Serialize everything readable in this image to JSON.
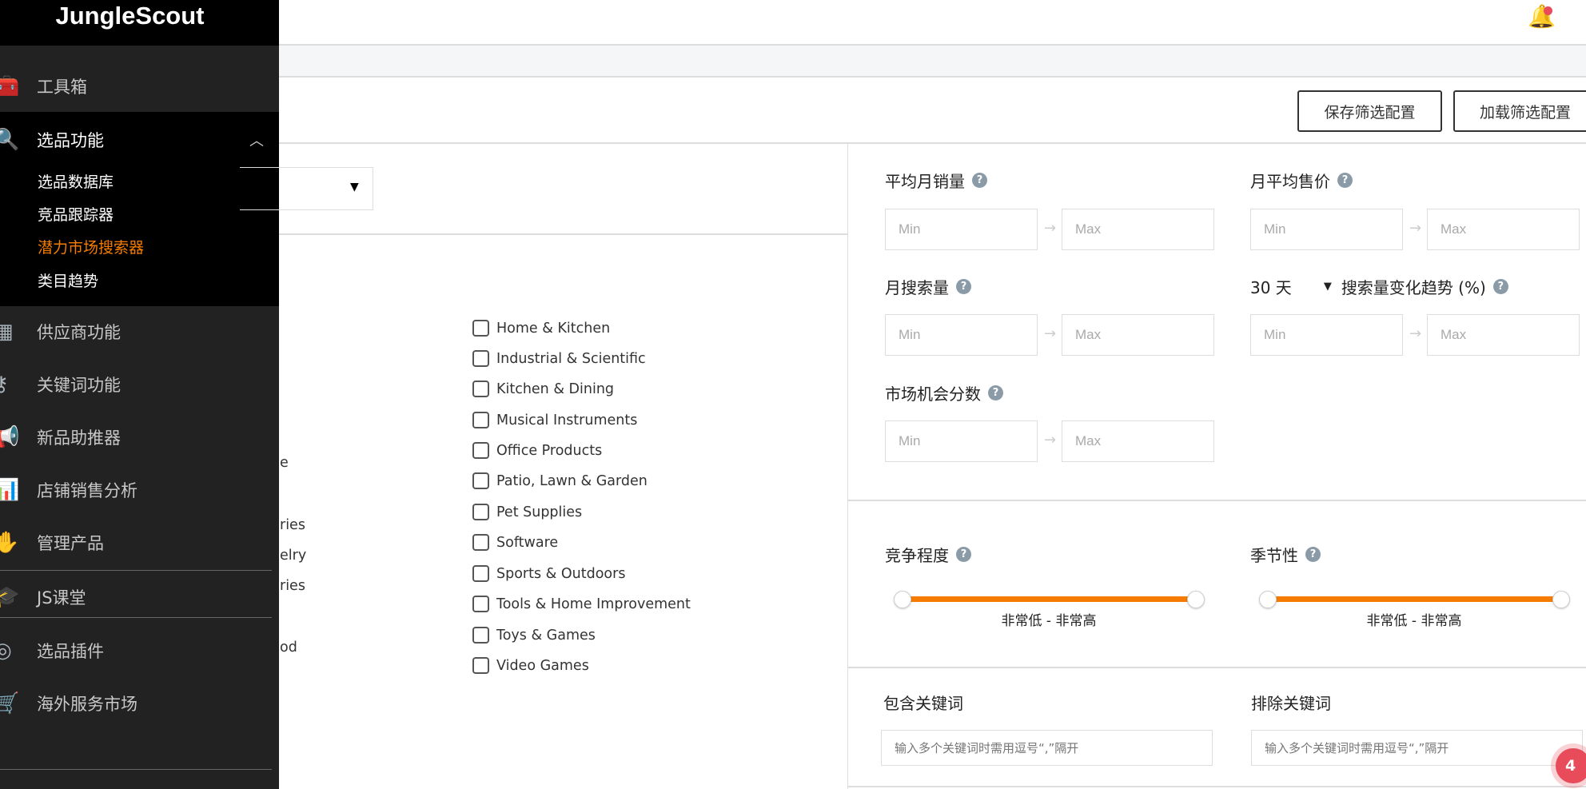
{
  "sidebar": {
    "logo": "JungleScout",
    "items": [
      {
        "label": "工具箱",
        "icon": "toolbox-icon"
      },
      {
        "label": "选品功能",
        "icon": "product-search-icon",
        "expanded": true,
        "children": [
          "选品数据库",
          "竞品跟踪器",
          "潜力市场搜索器",
          "类目趋势"
        ],
        "active_child": "潜力市场搜索器"
      },
      {
        "label": "供应商功能",
        "icon": "factory-icon"
      },
      {
        "label": "关键词功能",
        "icon": "key-icon"
      },
      {
        "label": "新品助推器",
        "icon": "megaphone-icon"
      },
      {
        "label": "店铺销售分析",
        "icon": "bar-chart-icon"
      },
      {
        "label": "管理产品",
        "icon": "hand-box-icon"
      },
      {
        "label": "JS课堂",
        "icon": "graduation-cap-icon"
      },
      {
        "label": "选品插件",
        "icon": "chrome-icon"
      },
      {
        "label": "海外服务市场",
        "icon": "cart-icon"
      }
    ]
  },
  "toolbar": {
    "save_label": "保存筛选配置",
    "load_label": "加载筛选配置"
  },
  "categories": {
    "partial_left": [
      "e",
      "ries",
      "elry",
      "ries",
      "od"
    ],
    "items": [
      "Home & Kitchen",
      "Industrial & Scientific",
      "Kitchen & Dining",
      "Musical Instruments",
      "Office Products",
      "Patio, Lawn & Garden",
      "Pet Supplies",
      "Software",
      "Sports & Outdoors",
      "Tools & Home Improvement",
      "Toys & Games",
      "Video Games"
    ]
  },
  "filters": {
    "min_placeholder": "Min",
    "max_placeholder": "Max",
    "avg_monthly_sales": "平均月销量",
    "avg_monthly_price": "月平均售价",
    "monthly_search_volume": "月搜索量",
    "trend_period": "30 天",
    "search_trend": "搜索量变化趋势 (%)",
    "opportunity_score": "市场机会分数",
    "competition": "竞争程度",
    "seasonality": "季节性",
    "competition_range": "非常低  -  非常高",
    "seasonality_range": "非常低  -  非常高",
    "include_keywords": "包含关键词",
    "exclude_keywords": "排除关键词",
    "keyword_placeholder": "输入多个关键词时需用逗号“,”隔开"
  },
  "notifications": {
    "badge_count": "4",
    "accent": "#f57c00",
    "alert": "#e84c5a"
  }
}
